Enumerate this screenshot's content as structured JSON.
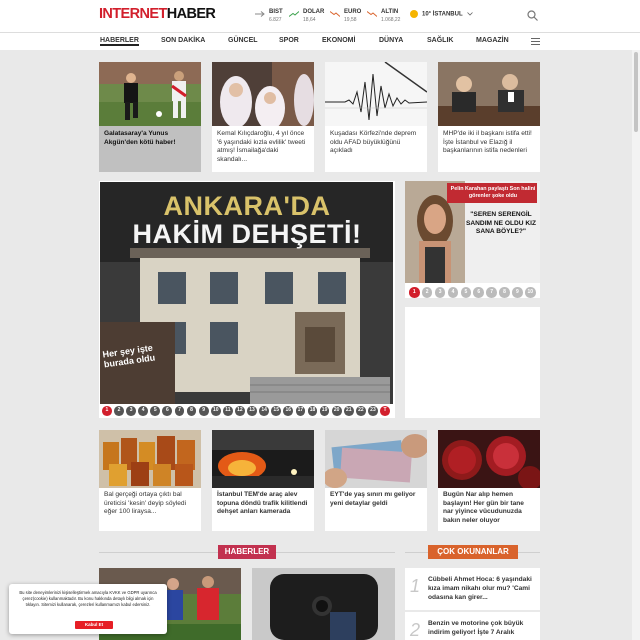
{
  "logo": {
    "part1": "INTERNET",
    "part2": "HABER"
  },
  "tickers": [
    {
      "name": "BIST",
      "value": "6.827",
      "trend": "flat"
    },
    {
      "name": "DOLAR",
      "value": "18,64",
      "trend": "up"
    },
    {
      "name": "EURO",
      "value": "19,58",
      "trend": "down"
    },
    {
      "name": "ALTIN",
      "value": "1.068,22",
      "trend": "down"
    }
  ],
  "weather": {
    "text": "10° İSTANBUL"
  },
  "nav": [
    "HABERLER",
    "SON DAKİKA",
    "GÜNCEL",
    "SPOR",
    "EKONOMİ",
    "DÜNYA",
    "SAĞLIK",
    "MAGAZİN"
  ],
  "top_news": [
    "Galatasaray'a Yunus Akgün'den kötü haber!",
    "Kemal Kılıçdaroğlu, 4 yıl önce '6 yaşındaki kızla evlilik' tweeti atmış! İsmailağa'daki skandalı...",
    "Kuşadası Körfezi'nde deprem oldu AFAD büyüklüğünü açıkladı",
    "MHP'de iki il başkanı istifa etti! İşte İstanbul ve Elazığ il başkanlarının istifa nedenleri"
  ],
  "hero": {
    "title1": "ANKARA'DA",
    "title2": "HAKİM DEHŞETİ!",
    "badge": "Her şey işte burada oldu",
    "pages": [
      "1",
      "2",
      "3",
      "4",
      "5",
      "6",
      "7",
      "8",
      "9",
      "10",
      "11",
      "12",
      "13",
      "14",
      "15",
      "16",
      "17",
      "18",
      "19",
      "20",
      "21",
      "22",
      "23",
      "T"
    ]
  },
  "side_slider": {
    "banner": "Pelin Karahan paylaştı Son halini görenler şoke oldu",
    "quote": "\"SEREN SERENGİL SANDIM NE OLDU KIZ SANA BÖYLE?\"",
    "pages": [
      "1",
      "2",
      "3",
      "4",
      "5",
      "6",
      "7",
      "8",
      "9",
      "10"
    ]
  },
  "mid_news": [
    "Bal gerçeği ortaya çıktı bal üreticisi 'kesin' deyip söyledi eğer 100 liraysa...",
    "İstanbul TEM'de araç alev topuna döndü trafik kilitlendi dehşet anları kamerada",
    "EYT'de yaş sınırı mı geliyor yeni detaylar geldi",
    "Bugün Nar alıp hemen başlayın! Her gün bir tane nar yiyince vücudunuzda bakın neler oluyor"
  ],
  "sections": {
    "haberler": "HABERLER",
    "cok_okunanlar": "ÇOK OKUNANLAR"
  },
  "cok_okunanlar": [
    {
      "num": "1",
      "title": "Cübbeli Ahmet Hoca: 6 yaşındaki kıza imam nikahı olur mu? 'Cami odasına kan girer..."
    },
    {
      "num": "2",
      "title": "Benzin ve motorine çok büyük indirim geliyor! İşte 7 Aralık"
    }
  ],
  "cookie": {
    "text": "Bu site deneyimlerinizi kişiselleştirmek amacıyla KVKK ve GDPR uyarınca çerez(cookie) kullanmaktadır. Bu konu hakkında detaylı bilgi almak için tıklayın. Sitemizi kullanarak, çerezleri kullanmamızı kabul edersiniz.",
    "button": "Kabul Et"
  },
  "colors": {
    "brand_red": "#d21f2c",
    "haberler_head": "#c2314f",
    "cok_okunanlar_head": "#d9632c"
  }
}
